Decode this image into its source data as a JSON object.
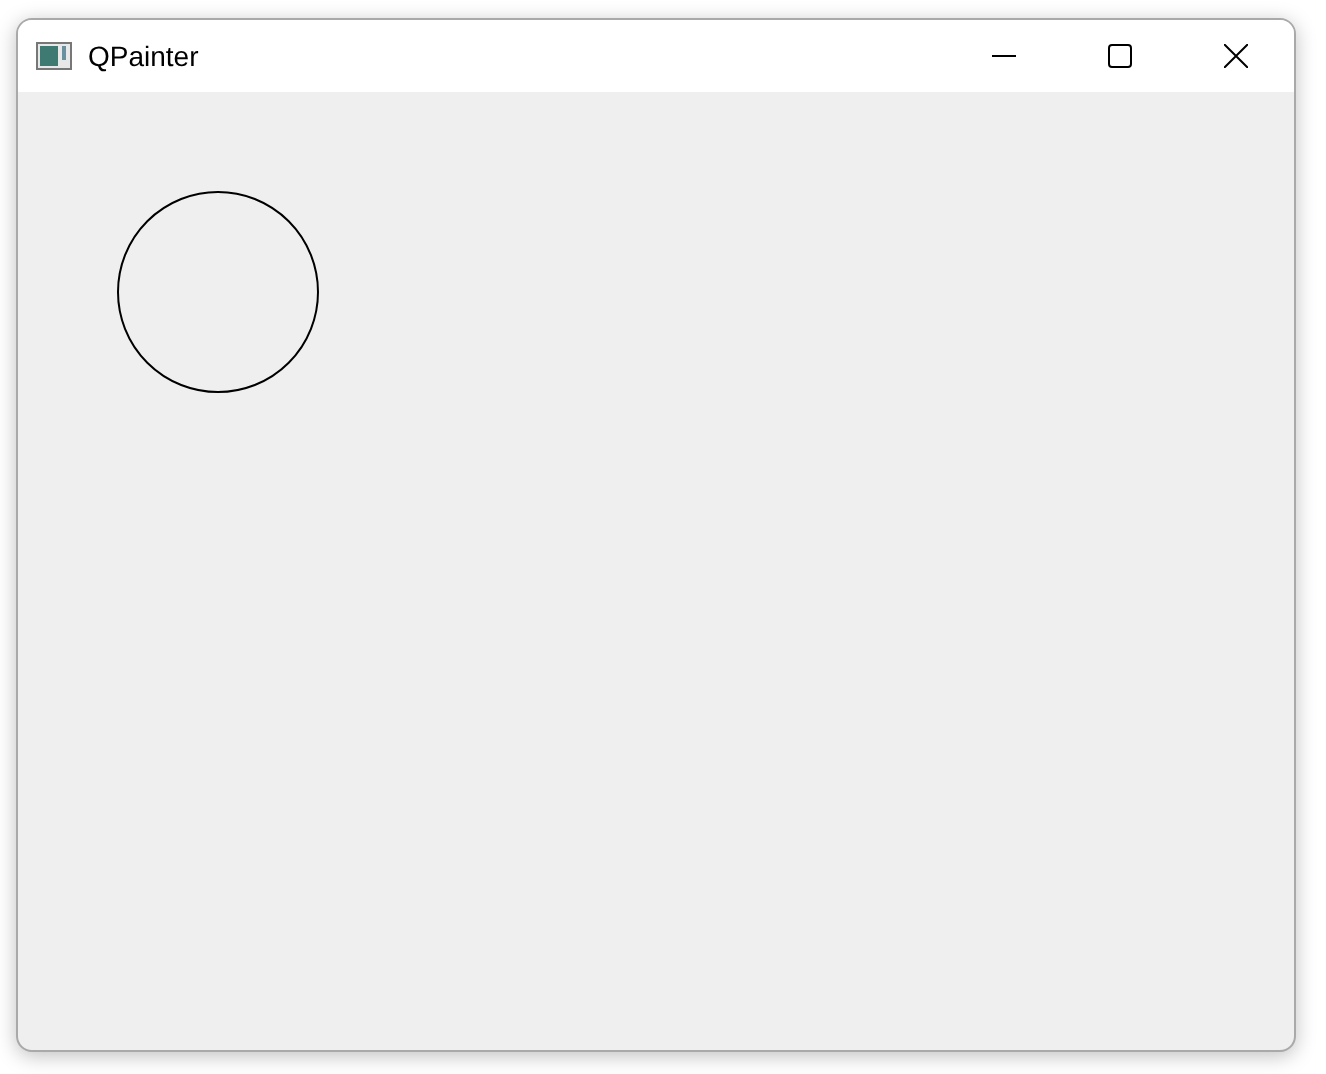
{
  "window": {
    "title": "QPainter",
    "controls": [
      {
        "kind": "minimize"
      },
      {
        "kind": "maximize"
      },
      {
        "kind": "close"
      }
    ]
  },
  "canvas": {
    "shapes": [
      {
        "kind": "circle"
      }
    ]
  }
}
